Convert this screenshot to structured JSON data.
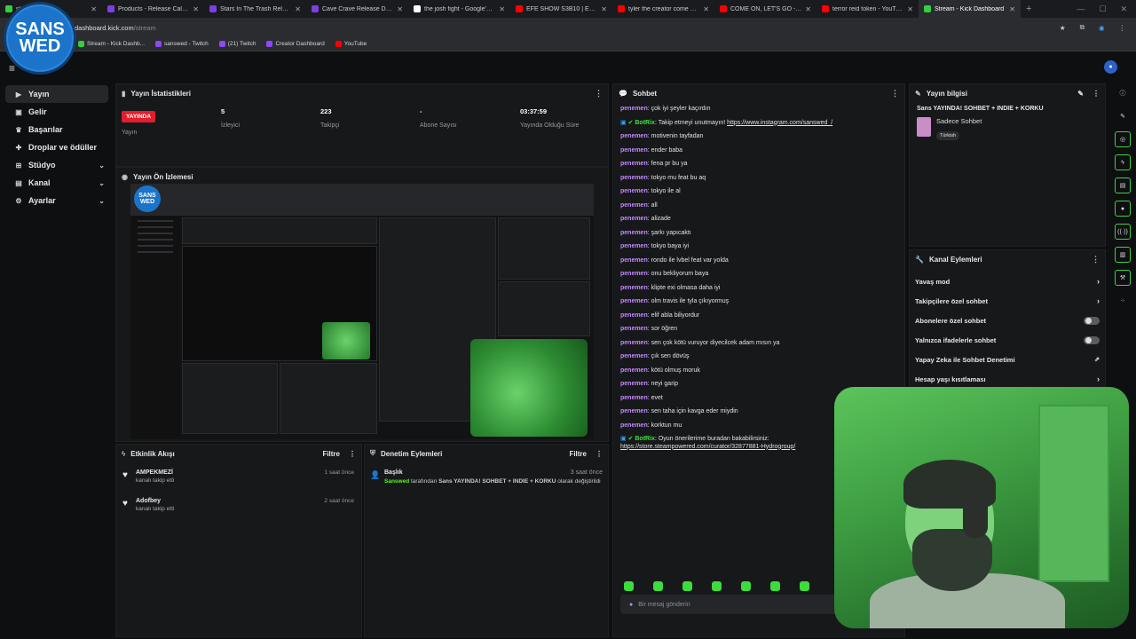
{
  "browser": {
    "tabs": [
      {
        "label": "sk",
        "color": "#2fd13f"
      },
      {
        "label": "Products - Release Calendar",
        "color": "#7b3fe4"
      },
      {
        "label": "Stars In The Trash Release Da",
        "color": "#7b3fe4"
      },
      {
        "label": "Cave Crave Release Dates",
        "color": "#7b3fe4"
      },
      {
        "label": "the josh fight - Google'da Ara",
        "color": "#ffffff"
      },
      {
        "label": "EFE SHOW S3B10 | ENİS KİRA",
        "color": "#ff0000"
      },
      {
        "label": "tyler the creator come on let's",
        "color": "#ff0000"
      },
      {
        "label": "COME ON, LET'S GO - YouTu",
        "color": "#ff0000"
      },
      {
        "label": "terror reid token - YouTube",
        "color": "#ff0000"
      },
      {
        "label": "Stream - Kick Dashboard",
        "color": "#2fd13f",
        "active": true
      }
    ],
    "url_prefix": "dashboard.kick.com",
    "url_path": "/stream",
    "bookmarks": [
      {
        "label": "Stream - Kick Dashb...",
        "color": "#2fd13f"
      },
      {
        "label": "sanswed - Twitch",
        "color": "#9146ff"
      },
      {
        "label": "(21) Twitch",
        "color": "#9146ff"
      },
      {
        "label": "Creator Dashboard",
        "color": "#9146ff"
      },
      {
        "label": "YouTube",
        "color": "#ff0000"
      }
    ]
  },
  "logo": {
    "line1": "SANS",
    "line2": "WED"
  },
  "sidebar": {
    "items": [
      {
        "label": "Yayın",
        "icon": "video-icon"
      },
      {
        "label": "Gelir",
        "icon": "wallet-icon"
      },
      {
        "label": "Başarılar",
        "icon": "trophy-icon"
      },
      {
        "label": "Droplar ve ödüller",
        "icon": "gift-icon"
      },
      {
        "label": "Stüdyo",
        "icon": "studio-icon"
      },
      {
        "label": "Kanal",
        "icon": "channel-icon"
      },
      {
        "label": "Ayarlar",
        "icon": "gear-icon"
      }
    ]
  },
  "stats": {
    "title": "Yayın İstatistikleri",
    "live_badge": "YAYINDA",
    "items": [
      {
        "value": "",
        "label": "Yayın"
      },
      {
        "value": "5",
        "label": "İzleyici"
      },
      {
        "value": "223",
        "label": "Takipçi"
      },
      {
        "value": "-",
        "label": "Abone Sayısı"
      },
      {
        "value": "03:37:59",
        "label": "Yayında Olduğu Süre"
      }
    ]
  },
  "preview": {
    "title": "Yayın Ön İzlemesi"
  },
  "activity": {
    "title": "Etkinlik Akışı",
    "filter": "Filtre",
    "events": [
      {
        "user": "AMPEKMEZİ",
        "desc": "kanalı takip etti",
        "time": "1 saat önce"
      },
      {
        "user": "Adofbey",
        "desc": "kanalı takip etti",
        "time": "2 saat önce"
      }
    ]
  },
  "moderation": {
    "title": "Denetim Eylemleri",
    "filter": "Filtre",
    "event": {
      "title": "Başlık",
      "time": "3 saat önce",
      "user": "Sanswed",
      "mid": " tarafından ",
      "value": "Sans YAYINDA! SOHBET + INDIE + KORKU",
      "end": " olarak değiştirildi"
    }
  },
  "chat": {
    "title": "Sohbet",
    "messages": [
      {
        "user": "penemen",
        "text": "çok iyi şeyler kaçırdın"
      },
      {
        "user": "BotRix",
        "bot": true,
        "text": "Takip etmeyi unutmayın! ",
        "link": "https://www.instagram.com/sanswed_/"
      },
      {
        "user": "penemen",
        "text": "motivenin tayfadan"
      },
      {
        "user": "penemen",
        "text": "ender baba"
      },
      {
        "user": "penemen",
        "text": "fena pr bu ya"
      },
      {
        "user": "penemen",
        "text": "tokyo mu feat bu aq"
      },
      {
        "user": "penemen",
        "text": "tokyo ile al"
      },
      {
        "user": "penemen",
        "text": "all"
      },
      {
        "user": "penemen",
        "text": "alizade"
      },
      {
        "user": "penemen",
        "text": "şarkı yapıcaktı"
      },
      {
        "user": "penemen",
        "text": "tokyo baya iyi"
      },
      {
        "user": "penemen",
        "text": "rondo ile lvbel feat var yolda"
      },
      {
        "user": "penemen",
        "text": "onu bekliyorum baya"
      },
      {
        "user": "penemen",
        "text": "klipte exi olmasa daha iyi"
      },
      {
        "user": "penemen",
        "text": "olm travis ile tyla çıkıyormuş"
      },
      {
        "user": "penemen",
        "text": "elif abla biliyordur"
      },
      {
        "user": "penemen",
        "text": "sor öğren"
      },
      {
        "user": "penemen",
        "text": "sen çok kötü vuruyor diyecilcek adam mısın ya"
      },
      {
        "user": "penemen",
        "text": "çık sen dövüş"
      },
      {
        "user": "penemen",
        "text": "kötü olmuş moruk"
      },
      {
        "user": "penemen",
        "text": "neyi garip"
      },
      {
        "user": "penemen",
        "text": "evet"
      },
      {
        "user": "penemen",
        "text": "sen taha için kavga eder miydin"
      },
      {
        "user": "penemen",
        "text": "korktun mu"
      },
      {
        "user": "BotRix",
        "bot": true,
        "text": "Oyun önerilerime buradan bakabilirsiniz:",
        "link2": "https://store.steampowered.com/curator/32877881-Hydrogroup/"
      }
    ],
    "placeholder": "Bir mesaj gönderin"
  },
  "stream_info": {
    "title": "Yayın bilgisi",
    "stream_title": "Sans YAYINDA! SOHBET + INDIE + KORKU",
    "category": "Sadece Sohbet",
    "language": "Türkish"
  },
  "channel_actions": {
    "title": "Kanal Eylemleri",
    "items": [
      {
        "label": "Yavaş mod",
        "type": "arrow"
      },
      {
        "label": "Takipçilere özel sohbet",
        "type": "arrow"
      },
      {
        "label": "Abonelere özel sohbet",
        "type": "toggle"
      },
      {
        "label": "Yalnızca ifadelerle sohbet",
        "type": "toggle"
      },
      {
        "label": "Yapay Zeka ile Sohbet Denetimi",
        "type": "external"
      },
      {
        "label": "Hesap yaşı kısıtlaması",
        "type": "arrow"
      }
    ]
  },
  "colors": {
    "accent": "#53fc18",
    "live": "#e11e2d",
    "username": "#c389ff",
    "bot": "#3be23b"
  }
}
